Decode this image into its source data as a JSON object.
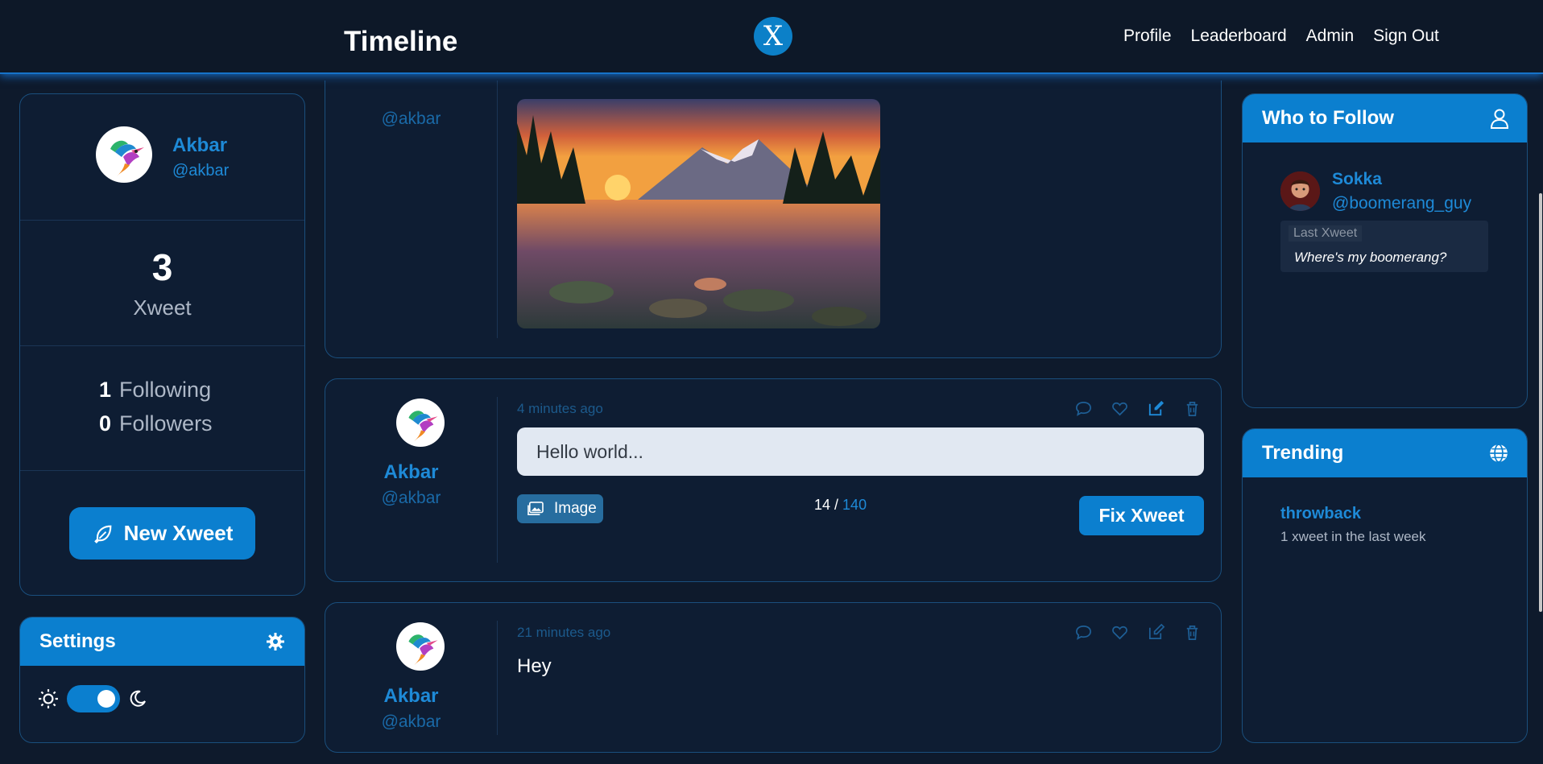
{
  "header": {
    "title": "Timeline",
    "logo_letter": "X",
    "nav": [
      "Profile",
      "Leaderboard",
      "Admin",
      "Sign Out"
    ]
  },
  "profile": {
    "name": "Akbar",
    "handle": "@akbar",
    "xweet_count": "3",
    "xweet_label": "Xweet",
    "following_count": "1",
    "following_label": "Following",
    "followers_count": "0",
    "followers_label": "Followers",
    "new_xweet_label": "New Xweet"
  },
  "settings": {
    "title": "Settings",
    "dark_mode_on": true
  },
  "feed": {
    "top_post": {
      "handle": "@akbar",
      "image_alt": "Mountain lake at sunset"
    },
    "edit_post": {
      "name": "Akbar",
      "handle": "@akbar",
      "time": "4 minutes ago",
      "input_value": "Hello world...",
      "image_label": "Image",
      "count": "14",
      "separator": " / ",
      "max": "140",
      "fix_label": "Fix Xweet"
    },
    "post": {
      "name": "Akbar",
      "handle": "@akbar",
      "time": "21 minutes ago",
      "text": "Hey"
    }
  },
  "who_to_follow": {
    "title": "Who to Follow",
    "user": {
      "name": "Sokka",
      "handle": "@boomerang_guy",
      "last_label": "Last Xweet",
      "last_text": "Where's my boomerang?"
    }
  },
  "trending": {
    "title": "Trending",
    "items": [
      {
        "tag": "throwback",
        "meta": "1 xweet in the last week"
      }
    ]
  },
  "colors": {
    "accent": "#0b7fcf",
    "link": "#1e8ad7",
    "background": "#0e1a2c"
  }
}
